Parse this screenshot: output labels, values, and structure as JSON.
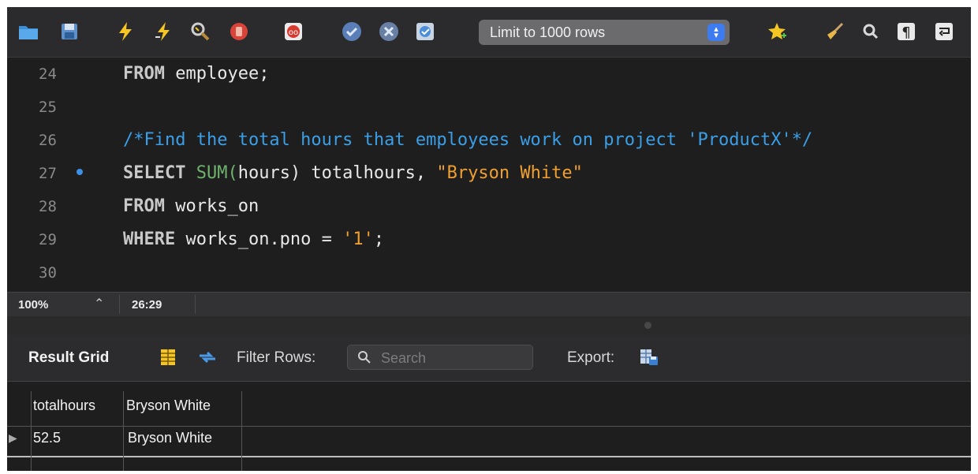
{
  "toolbar": {
    "limit_rows": "Limit to 1000 rows"
  },
  "editor": {
    "lines": [
      {
        "num": "24"
      },
      {
        "num": "25"
      },
      {
        "num": "26"
      },
      {
        "num": "27"
      },
      {
        "num": "28"
      },
      {
        "num": "29"
      },
      {
        "num": "30"
      }
    ],
    "line24": {
      "kw": "FROM",
      "rest": " employee;"
    },
    "line26": {
      "comment": "/*Find the total hours that employees work on project 'ProductX'*/"
    },
    "line27": {
      "kw": "SELECT",
      "fn": "SUM(",
      "mid": "hours) totalhours, ",
      "str": "\"Bryson White\""
    },
    "line28": {
      "kw": "FROM",
      "rest": " works_on"
    },
    "line29": {
      "kw": "WHERE",
      "rest": " works_on.pno = ",
      "str": "'1'",
      "end": ";"
    }
  },
  "status": {
    "zoom": "100%",
    "cursor": "26:29"
  },
  "result": {
    "title": "Result Grid",
    "filter_label": "Filter Rows:",
    "search_placeholder": "Search",
    "export_label": "Export:"
  },
  "grid": {
    "columns": [
      "totalhours",
      "Bryson White"
    ],
    "rows": [
      [
        "52.5",
        "Bryson White"
      ]
    ]
  },
  "colors": {
    "keyword": "#c8c8c8",
    "function": "#6db36d",
    "string": "#f0a030",
    "comment": "#3b9fe8",
    "accent": "#3d7cf0"
  }
}
